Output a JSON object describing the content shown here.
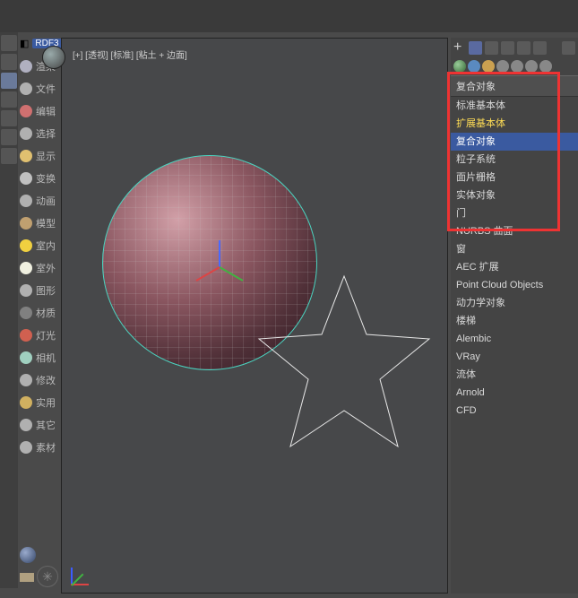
{
  "viewport": {
    "label": "[+] [透视] [标准] [粘土 + 边面]"
  },
  "sidebar": {
    "badge": "RDF3",
    "items": [
      {
        "label": "渲染",
        "icon": "render-icon",
        "color": "#b0b0c0"
      },
      {
        "label": "文件",
        "icon": "file-icon",
        "color": "#b0b0b0"
      },
      {
        "label": "编辑",
        "icon": "edit-icon",
        "color": "#d07070"
      },
      {
        "label": "选择",
        "icon": "select-icon",
        "color": "#b0b0b0"
      },
      {
        "label": "显示",
        "icon": "display-icon",
        "color": "#e0c070"
      },
      {
        "label": "变换",
        "icon": "transform-icon",
        "color": "#c0c0c0"
      },
      {
        "label": "动画",
        "icon": "anim-icon",
        "color": "#b0b0b0"
      },
      {
        "label": "模型",
        "icon": "model-icon",
        "color": "#c0a070"
      },
      {
        "label": "室内",
        "icon": "interior-icon",
        "color": "#f0d040"
      },
      {
        "label": "室外",
        "icon": "exterior-icon",
        "color": "#f0f0e0"
      },
      {
        "label": "图形",
        "icon": "shape-icon",
        "color": "#b0b0b0"
      },
      {
        "label": "材质",
        "icon": "material-icon",
        "color": "#808080"
      },
      {
        "label": "灯光",
        "icon": "light-icon",
        "color": "#d06050"
      },
      {
        "label": "相机",
        "icon": "camera-icon",
        "color": "#a0d0c0"
      },
      {
        "label": "修改",
        "icon": "modify-icon",
        "color": "#b0b0b0"
      },
      {
        "label": "实用",
        "icon": "util-icon",
        "color": "#d0b060"
      },
      {
        "label": "其它",
        "icon": "other-icon",
        "color": "#b0b0b0"
      },
      {
        "label": "素材",
        "icon": "asset-icon",
        "color": "#b0b0b0"
      }
    ]
  },
  "panel": {
    "category_header": "复合对象",
    "geom_types_a": [
      {
        "label": "标准基本体",
        "sel": false,
        "hl": false
      },
      {
        "label": "扩展基本体",
        "sel": false,
        "hl": true
      },
      {
        "label": "复合对象",
        "sel": true,
        "hl": false
      },
      {
        "label": "粒子系统",
        "sel": false,
        "hl": false
      },
      {
        "label": "面片栅格",
        "sel": false,
        "hl": false
      },
      {
        "label": "实体对象",
        "sel": false,
        "hl": false
      },
      {
        "label": "门",
        "sel": false,
        "hl": false
      },
      {
        "label": "NURBS 曲面",
        "sel": false,
        "hl": false
      }
    ],
    "geom_types_b": [
      {
        "label": "窗"
      },
      {
        "label": "AEC 扩展"
      },
      {
        "label": "Point Cloud Objects"
      },
      {
        "label": "动力学对象"
      },
      {
        "label": "楼梯"
      },
      {
        "label": "Alembic"
      },
      {
        "label": "VRay"
      },
      {
        "label": "流体"
      },
      {
        "label": "Arnold"
      },
      {
        "label": "CFD"
      }
    ]
  },
  "colors": {
    "accent": "#3a5aa0",
    "highlight": "#e33",
    "warn_text": "#ffdd55"
  }
}
